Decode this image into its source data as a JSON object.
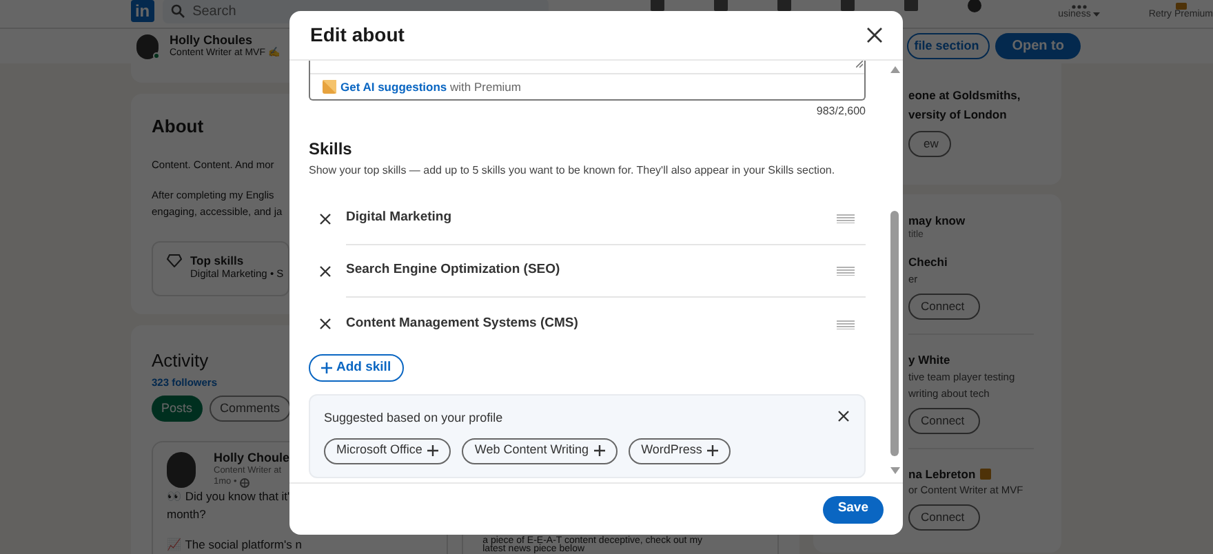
{
  "top_nav": {
    "logo": "in",
    "search_placeholder": "Search",
    "business": "usiness",
    "premium": "Retry Premium"
  },
  "profile_bar": {
    "name": "Holly Choules",
    "headline": "Content Writer at MVF ✍️",
    "buttons": [
      {
        "label": "file section",
        "primary": false
      },
      {
        "label": "Open to",
        "primary": true
      }
    ]
  },
  "about": {
    "title": "About",
    "lines": [
      "Content. Content. And mor",
      "After completing my Englis",
      "engaging, accessible, and ja"
    ],
    "top_skills": {
      "title": "Top skills",
      "text": "Digital Marketing • S"
    }
  },
  "activity": {
    "title": "Activity",
    "followers": "323 followers",
    "tabs": [
      {
        "label": "Posts",
        "selected": true
      },
      {
        "label": "Comments",
        "selected": false
      }
    ],
    "post": {
      "author": "Holly Choule",
      "headline": "Content Writer at",
      "meta": "1mo •",
      "lines": [
        "👀 Did you know that it'",
        "month?",
        "📈 The social platform's n"
      ]
    },
    "next_post_lines": [
      "a piece of E-E-A-T content deceptive, check out my",
      "latest news piece below"
    ]
  },
  "right_rail": {
    "card_lines": [
      "eone at Goldsmiths,",
      "versity of London"
    ],
    "card_button": "ew",
    "people_title": "may know",
    "people_subtitle": "title",
    "people": [
      {
        "name": "Chechi",
        "lines": [
          "er"
        ],
        "linkedin_badge": false,
        "button": "Connect"
      },
      {
        "name": "y White",
        "lines": [
          "tive team player testing",
          "writing about tech"
        ],
        "linkedin_badge": false,
        "button": "Connect"
      },
      {
        "name": "na Lebreton",
        "lines": [
          "or Content Writer at MVF"
        ],
        "linkedin_badge": true,
        "button": "Connect"
      }
    ]
  },
  "modal": {
    "title": "Edit about",
    "ai_link": "Get AI suggestions",
    "ai_suffix": "with Premium",
    "counter": "983/2,600",
    "skills_title": "Skills",
    "skills_hint": "Show your top skills — add up to 5 skills you want to be known for. They'll also appear in your Skills section.",
    "skills": [
      "Digital Marketing",
      "Search Engine Optimization (SEO)",
      "Content Management Systems (CMS)"
    ],
    "add_skill": "Add skill",
    "suggestions": {
      "title": "Suggested based on your profile",
      "chips": [
        "Microsoft Office",
        "Web Content Writing",
        "WordPress"
      ]
    },
    "save": "Save"
  }
}
